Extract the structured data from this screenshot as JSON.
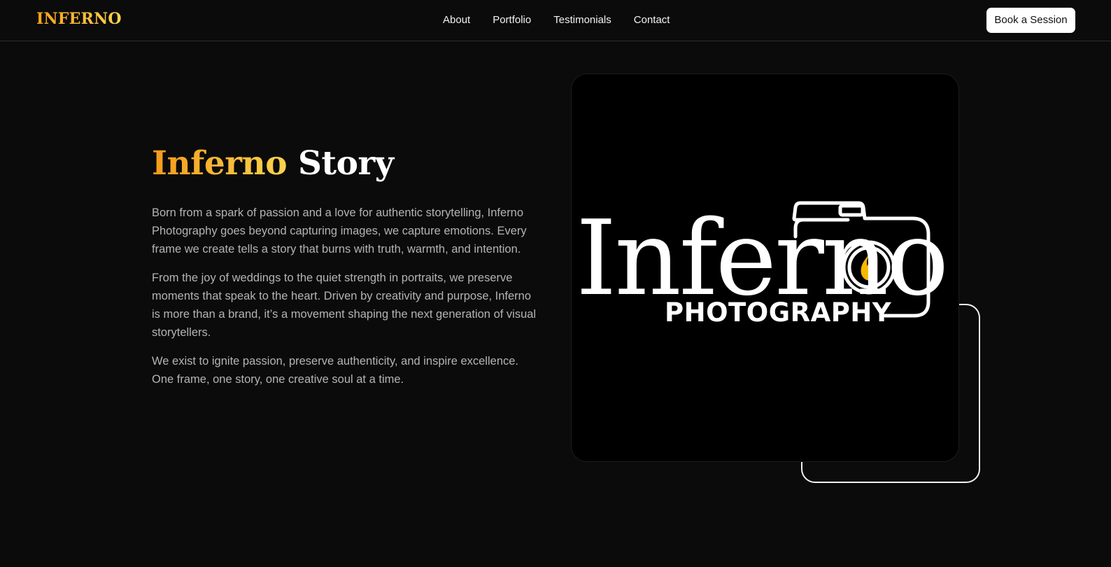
{
  "header": {
    "brand": "INFERNO",
    "nav": [
      "About",
      "Portfolio",
      "Testimonials",
      "Contact"
    ],
    "cta_label": "Book a Session"
  },
  "story": {
    "title_accent": "Inferno",
    "title_rest": "Story",
    "paragraphs": [
      "Born from a spark of passion and a love for authentic storytelling, Inferno Photography goes beyond capturing images, we capture emotions. Every frame we create tells a story that burns with truth, warmth, and intention.",
      "From the joy of weddings to the quiet strength in portraits, we preserve moments that speak to the heart. Driven by creativity and purpose, Inferno is more than a brand, it’s a movement shaping the next generation of visual storytellers.",
      "We exist to ignite passion, preserve authenticity, and inspire excellence. One frame, one story, one creative soul at a time."
    ]
  },
  "logo": {
    "wordmark": "Inferno",
    "subtitle": "PHOTOGRAPHY",
    "icon": "camera-flame-icon"
  },
  "colors": {
    "background": "#0b0b0b",
    "accent_start": "#f39b1a",
    "accent_end": "#fcd34d",
    "flame": "#f5b800",
    "cta_background": "#ffffff"
  }
}
